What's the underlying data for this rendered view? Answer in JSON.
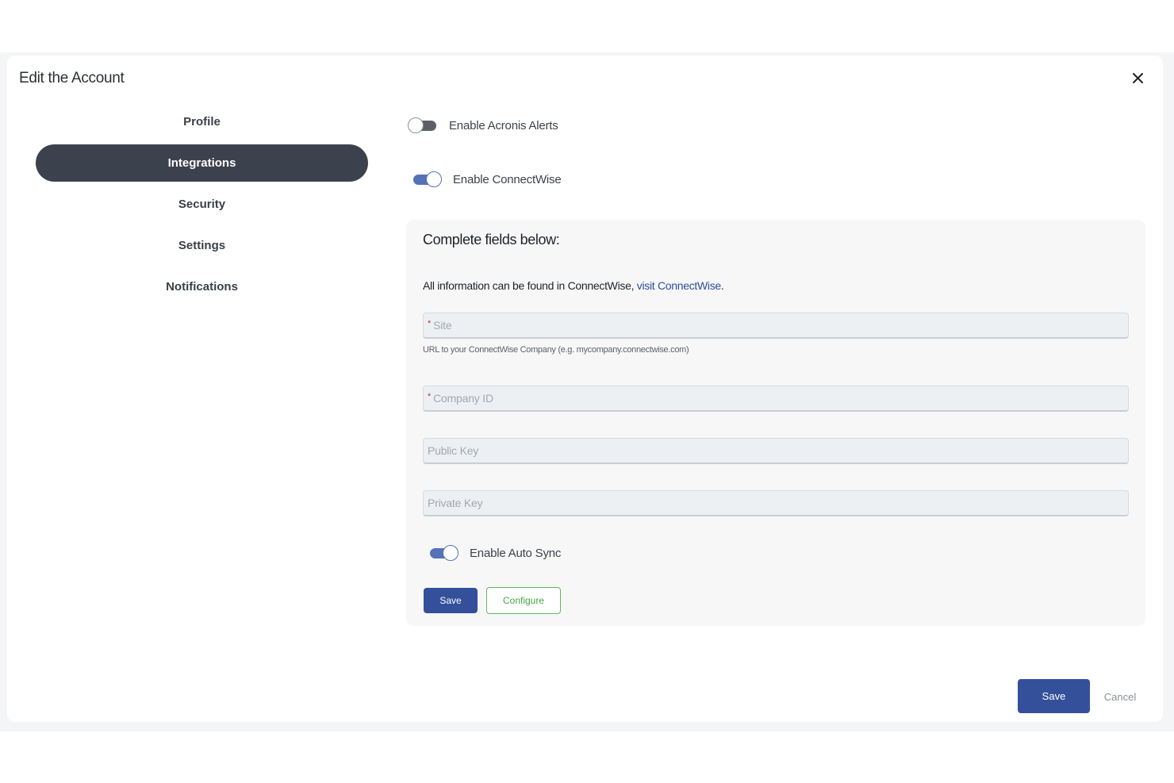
{
  "modal": {
    "title": "Edit the Account",
    "close_icon": "close-icon"
  },
  "nav": {
    "items": [
      {
        "label": "Profile",
        "active": false
      },
      {
        "label": "Integrations",
        "active": true
      },
      {
        "label": "Security",
        "active": false
      },
      {
        "label": "Settings",
        "active": false
      },
      {
        "label": "Notifications",
        "active": false
      }
    ]
  },
  "toggles": {
    "acronis": {
      "label": "Enable Acronis Alerts",
      "on": false
    },
    "connectwise": {
      "label": "Enable ConnectWise",
      "on": true
    },
    "autosync": {
      "label": "Enable Auto Sync",
      "on": true
    }
  },
  "panel": {
    "heading": "Complete fields below:",
    "info_prefix": "All information can be found in ConnectWise, ",
    "info_link": "visit ConnectWise",
    "info_suffix": ".",
    "site": {
      "required_mark": "*",
      "placeholder": "Site",
      "help": "URL to your ConnectWise Company (e.g. mycompany.connectwise.com)"
    },
    "company_id": {
      "required_mark": "*",
      "placeholder": "Company ID"
    },
    "public_key": {
      "placeholder": "Public Key"
    },
    "private_key": {
      "placeholder": "Private Key"
    },
    "save_label": "Save",
    "configure_label": "Configure"
  },
  "footer": {
    "save_label": "Save",
    "cancel_label": "Cancel"
  },
  "colors": {
    "primary": "#34509a",
    "nav_active": "#3c424d",
    "toggle_on": "#5572b8",
    "configure_green": "#45a84b",
    "link": "#2f4d9e"
  }
}
